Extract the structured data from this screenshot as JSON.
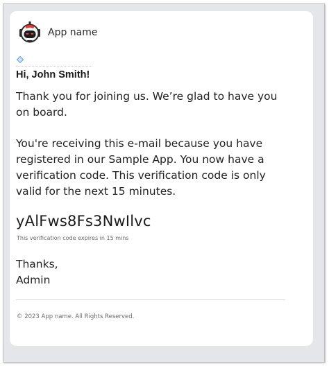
{
  "header": {
    "logo_icon": "robot-logo-icon",
    "app_name": "App name"
  },
  "email": {
    "greeting": "Hi, John Smith!",
    "paragraph_1": "Thank you for joining us. We’re glad to have you on board.",
    "paragraph_2": "You're receiving this e-mail because you have registered in our Sample App. You now have a verification code. This verification code is only valid for the next 15 minutes.",
    "verification_code": "yAlFws8Fs3NwIlvc",
    "expiry_note": "This verification code expires in 15 mins",
    "signoff": "Thanks,",
    "signature": "Admin"
  },
  "footer": {
    "copyright": "© 2023 App name. All Rights Reserved."
  },
  "colors": {
    "frame_background": "#e4e6ea",
    "card_background": "#ffffff",
    "text": "#222222",
    "muted_text": "#6a6a6a",
    "anchor_icon": "#5aa0e0",
    "logo_accent": "#e53935"
  }
}
